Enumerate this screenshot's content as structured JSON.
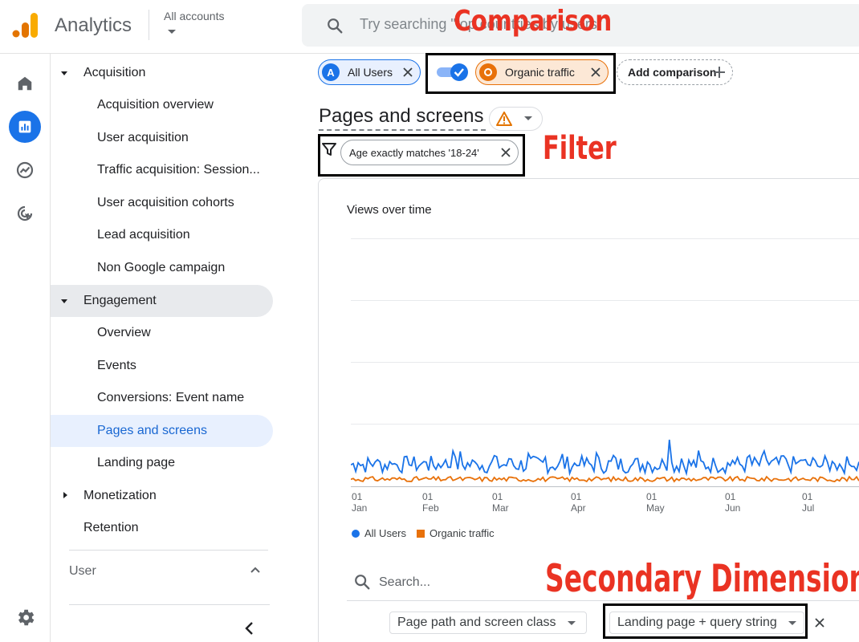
{
  "header": {
    "app_name": "Analytics",
    "account_label": "All accounts",
    "search_placeholder": "Try searching \"top countries by users\""
  },
  "rail": {
    "icons": [
      "home-icon",
      "reports-icon",
      "explore-icon",
      "advertising-icon"
    ]
  },
  "nav": {
    "acquisition": {
      "label": "Acquisition",
      "items": [
        "Acquisition overview",
        "User acquisition",
        "Traffic acquisition: Session...",
        "User acquisition cohorts",
        "Lead acquisition",
        "Non Google campaign"
      ]
    },
    "engagement": {
      "label": "Engagement",
      "items": [
        "Overview",
        "Events",
        "Conversions: Event name",
        "Pages and screens",
        "Landing page"
      ]
    },
    "monetization": "Monetization",
    "retention": "Retention",
    "user": "User"
  },
  "comparisons": {
    "all_users": {
      "badge": "A",
      "label": "All Users"
    },
    "organic": {
      "badge": "O",
      "label": "Organic traffic"
    },
    "add": "Add comparison"
  },
  "page": {
    "title": "Pages and screens",
    "filter": "Age exactly matches '18-24'"
  },
  "annotations": {
    "comparison": "Comparison",
    "filter": "Filter",
    "secondary": "Secondary Dimension"
  },
  "chart_data": {
    "type": "line",
    "title": "Views over time",
    "x_ticks": [
      {
        "day": "01",
        "month": "Jan"
      },
      {
        "day": "01",
        "month": "Feb"
      },
      {
        "day": "01",
        "month": "Mar"
      },
      {
        "day": "01",
        "month": "Apr"
      },
      {
        "day": "01",
        "month": "May"
      },
      {
        "day": "01",
        "month": "Jun"
      },
      {
        "day": "01",
        "month": "Jul"
      }
    ],
    "series": [
      {
        "name": "All Users",
        "color": "#1a73e8"
      },
      {
        "name": "Organic traffic",
        "color": "#e8710a"
      }
    ],
    "grid": true,
    "legend": "bottom-left"
  },
  "table": {
    "search_placeholder": "Search...",
    "primary_dimension": "Page path and screen class",
    "secondary_dimension": "Landing page + query string"
  },
  "colors": {
    "accent": "#1a73e8",
    "organic": "#e8710a",
    "annotation": "#ea3323"
  }
}
